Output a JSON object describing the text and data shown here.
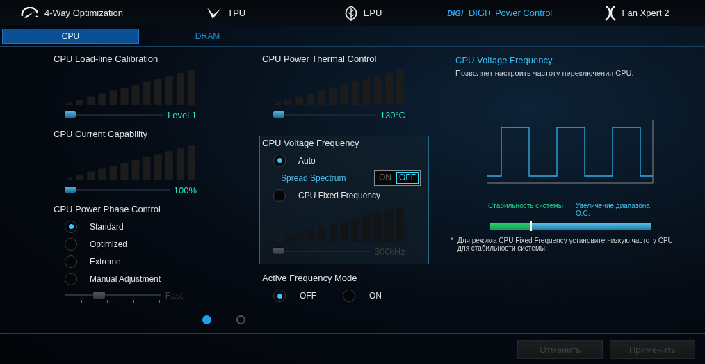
{
  "nav": [
    {
      "label": "4-Way Optimization",
      "selected": false
    },
    {
      "label": "TPU",
      "selected": false
    },
    {
      "label": "EPU",
      "selected": false
    },
    {
      "label": "DIGI+ Power Control",
      "logo_text": "DIGI",
      "selected": true
    },
    {
      "label": "Fan Xpert 2",
      "selected": false
    }
  ],
  "subtabs": [
    {
      "label": "CPU",
      "selected": true
    },
    {
      "label": "DRAM",
      "selected": false
    }
  ],
  "columns": [
    [
      {
        "kind": "meter",
        "title": "CPU Load-line Calibration",
        "level": 0,
        "reading": "Level 1",
        "disabled": false
      },
      {
        "kind": "meter",
        "title": "CPU Current Capability",
        "level": 0,
        "reading": "100%",
        "disabled": false
      },
      {
        "kind": "radios",
        "title": "CPU Power Phase Control",
        "options": [
          {
            "label": "Standard",
            "selected": true
          },
          {
            "label": "Optimized",
            "selected": false
          },
          {
            "label": "Extreme",
            "selected": false
          },
          {
            "label": "Manual Adjustment",
            "selected": false
          }
        ],
        "slider": {
          "level": 0.333,
          "reading": "Fast",
          "disabled": true
        }
      }
    ],
    [
      {
        "kind": "meter",
        "title": "CPU Power Thermal Control",
        "level": 0,
        "reading": "130°C",
        "disabled": false
      },
      {
        "kind": "frequency_box",
        "title": "CPU Voltage Frequency",
        "auto": {
          "label": "Auto",
          "selected": true
        },
        "spread": {
          "label": "Spread Spectrum",
          "options": [
            {
              "label": "ON",
              "selected": false
            },
            {
              "label": "OFF",
              "selected": true
            }
          ]
        },
        "fixed": {
          "label": "CPU Fixed Frequency",
          "selected": false
        },
        "meter": {
          "level": 0,
          "reading": "300kHz",
          "disabled": true
        }
      },
      {
        "kind": "inline_radios",
        "title": "Active Frequency Mode",
        "options": [
          {
            "label": "OFF",
            "selected": true
          },
          {
            "label": "ON",
            "selected": false
          }
        ]
      }
    ]
  ],
  "pager": [
    {
      "selected": true
    },
    {
      "selected": false
    }
  ],
  "info": {
    "title": "CPU Voltage Frequency",
    "description": "Позволяет настроить частоту переключения CPU.",
    "left_label": "Стабильность системы",
    "right_label": "Увеличение диапазона О.С.",
    "level": 0.25,
    "note_mark": "*",
    "note": "Для режима CPU Fixed Frequency установите низкую частоту CPU для стабильности системы."
  },
  "buttons": [
    {
      "label": "Отменить",
      "disabled": true
    },
    {
      "label": "Применить",
      "disabled": true
    }
  ]
}
